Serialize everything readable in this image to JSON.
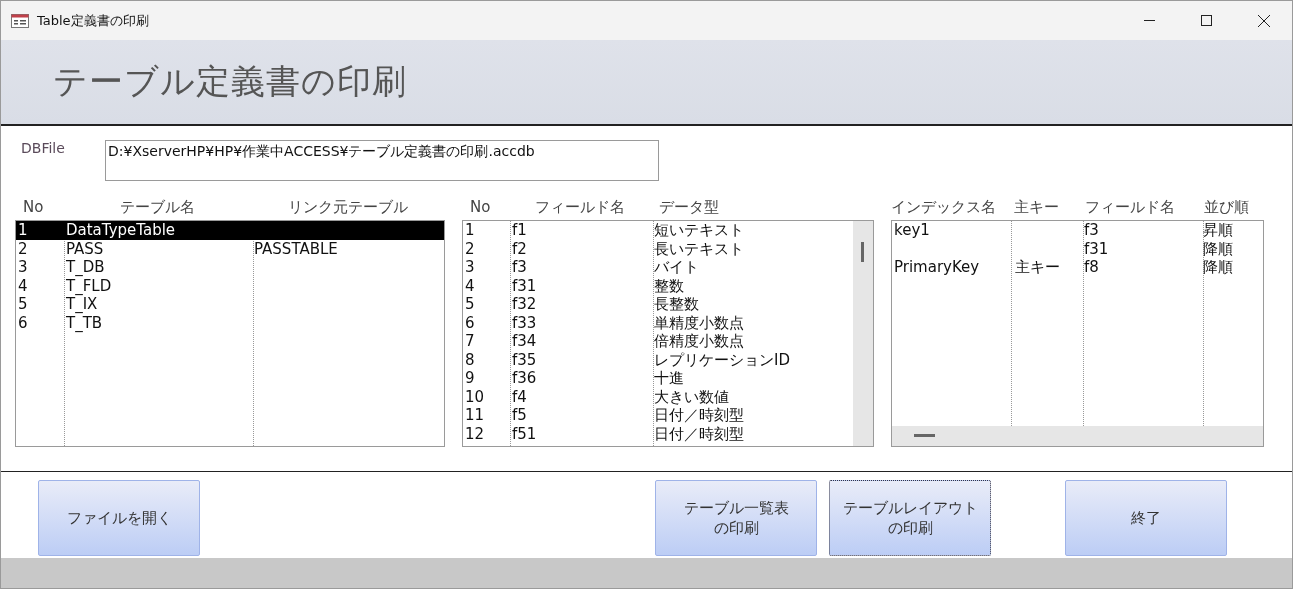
{
  "window": {
    "title": "Table定義書の印刷"
  },
  "header": {
    "title": "テーブル定義書の印刷"
  },
  "db_file": {
    "label": "DBFile",
    "value": "D:¥XserverHP¥HP¥作業中ACCESS¥テーブル定義書の印刷.accdb"
  },
  "tables": {
    "columns": [
      "No",
      "テーブル名",
      "リンク元テーブル"
    ],
    "rows": [
      {
        "no": "1",
        "name": "DataTypeTable",
        "selected": true
      },
      {
        "no": "2",
        "name": "PASS",
        "link": "PASSTABLE",
        "selected": false
      },
      {
        "no": "3",
        "name": "T_DB",
        "selected": false
      },
      {
        "no": "4",
        "name": "T_FLD",
        "selected": false
      },
      {
        "no": "5",
        "name": "T_IX",
        "selected": false
      },
      {
        "no": "6",
        "name": "T_TB",
        "selected": false
      }
    ]
  },
  "fields": {
    "columns": [
      "No",
      "フィールド名",
      "データ型"
    ],
    "rows": [
      {
        "no": "1",
        "field": "f1",
        "type": "短いテキスト"
      },
      {
        "no": "2",
        "field": "f2",
        "type": "長いテキスト"
      },
      {
        "no": "3",
        "field": "f3",
        "type": "バイト"
      },
      {
        "no": "4",
        "field": "f31",
        "type": "整数"
      },
      {
        "no": "5",
        "field": "f32",
        "type": "長整数"
      },
      {
        "no": "6",
        "field": "f33",
        "type": "単精度小数点"
      },
      {
        "no": "7",
        "field": "f34",
        "type": "倍精度小数点"
      },
      {
        "no": "8",
        "field": "f35",
        "type": "レプリケーションID"
      },
      {
        "no": "9",
        "field": "f36",
        "type": "十進"
      },
      {
        "no": "10",
        "field": "f4",
        "type": "大きい数値"
      },
      {
        "no": "11",
        "field": "f5",
        "type": "日付／時刻型"
      },
      {
        "no": "12",
        "field": "f51",
        "type": "日付／時刻型"
      }
    ]
  },
  "indexes": {
    "columns": [
      "インデックス名",
      "主キー",
      "フィールド名",
      "並び順"
    ],
    "rows": [
      {
        "name": "key1",
        "fields": [
          {
            "field": "f3",
            "order": "昇順"
          },
          {
            "field": "f31",
            "order": "降順"
          }
        ]
      },
      {
        "name": "PrimaryKey",
        "primary_key": "主キー",
        "fields": [
          {
            "field": "f8",
            "order": "降順"
          }
        ]
      }
    ]
  },
  "buttons": [
    {
      "lines": [
        "ファイルを開く"
      ],
      "focused": false
    },
    {
      "lines": [
        "テーブル一覧表",
        "の印刷"
      ],
      "focused": false
    },
    {
      "lines": [
        "テーブルレイアウト",
        "の印刷"
      ],
      "focused": true
    },
    {
      "lines": [
        "終了"
      ],
      "focused": false
    }
  ]
}
